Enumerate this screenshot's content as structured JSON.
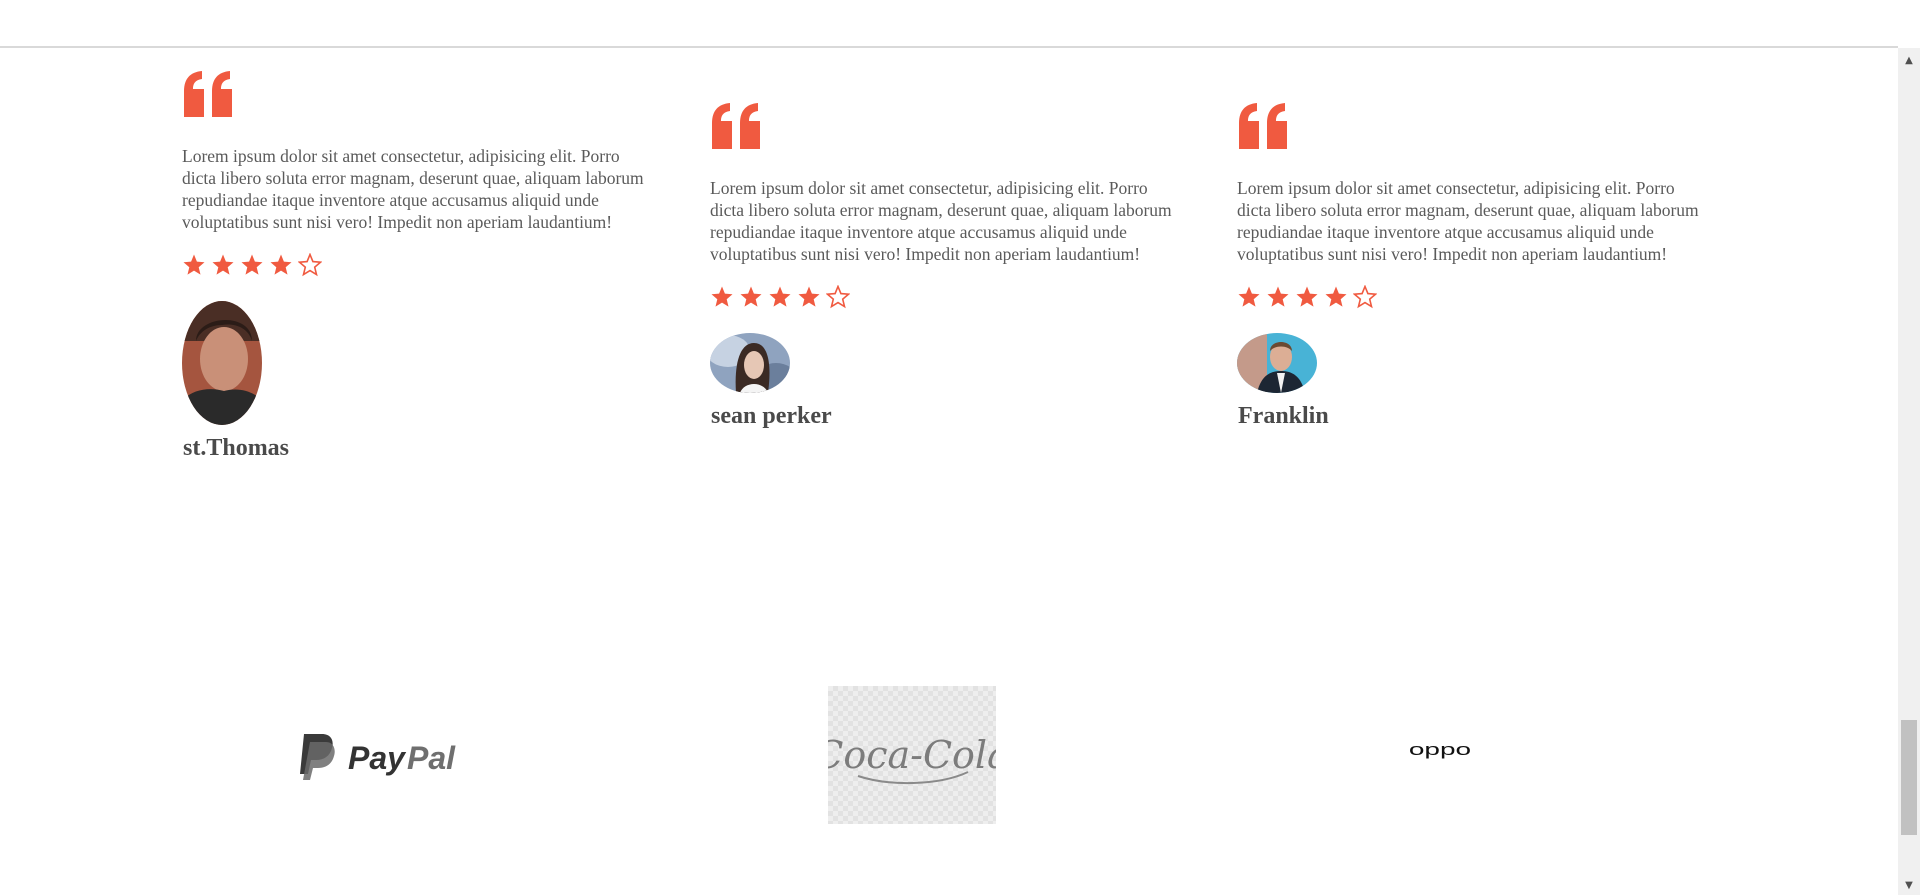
{
  "testimonials": [
    {
      "text": "Lorem ipsum dolor sit amet consectetur, adipisicing elit. Porro dicta libero soluta error magnam, deserunt quae, aliquam laborum repudiandae itaque inventore atque accusamus aliquid unde voluptatibus sunt nisi vero! Impedit non aperiam laudantium!",
      "rating": 4,
      "rating_max": 5,
      "name": "st.Thomas"
    },
    {
      "text": "Lorem ipsum dolor sit amet consectetur, adipisicing elit. Porro dicta libero soluta error magnam, deserunt quae, aliquam laborum repudiandae itaque inventore atque accusamus aliquid unde voluptatibus sunt nisi vero! Impedit non aperiam laudantium!",
      "rating": 4,
      "rating_max": 5,
      "name": "sean perker"
    },
    {
      "text": "Lorem ipsum dolor sit amet consectetur, adipisicing elit. Porro dicta libero soluta error magnam, deserunt quae, aliquam laborum repudiandae itaque inventore atque accusamus aliquid unde voluptatibus sunt nisi vero! Impedit non aperiam laudantium!",
      "rating": 4,
      "rating_max": 5,
      "name": "Franklin"
    }
  ],
  "logos": {
    "paypal": {
      "text_pay": "Pay",
      "text_pal": "Pal"
    },
    "cocacola": {
      "text": "Coca-Cola"
    },
    "oppo": {
      "text": "oppo"
    }
  },
  "colors": {
    "accent": "#f05a40",
    "text": "#5a5a5a",
    "name": "#4a4a4a"
  },
  "icons": {
    "quote": "quote-icon",
    "star_filled": "star-filled-icon",
    "star_empty": "star-empty-icon"
  }
}
